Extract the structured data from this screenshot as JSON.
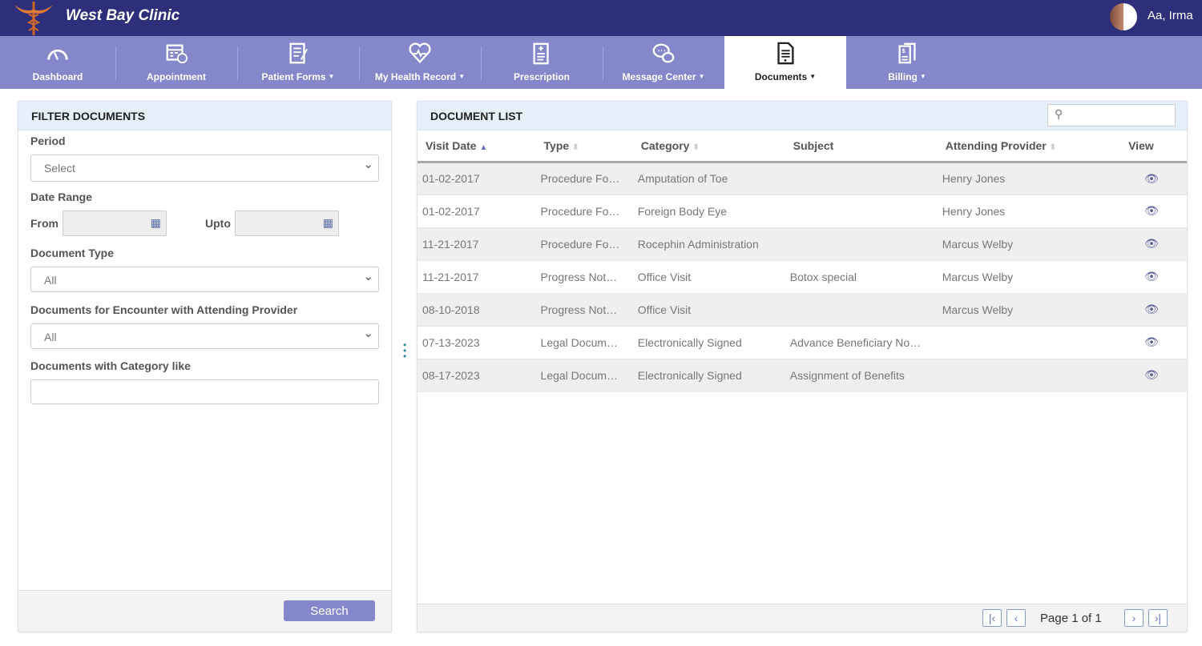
{
  "header": {
    "brand": "West Bay Clinic",
    "user": "Aa, Irma"
  },
  "nav": [
    {
      "label": "Dashboard",
      "icon": "speedometer-icon",
      "caret": false
    },
    {
      "label": "Appointment",
      "icon": "calendar-clock-icon",
      "caret": false
    },
    {
      "label": "Patient Forms",
      "icon": "form-pen-icon",
      "caret": true
    },
    {
      "label": "My Health Record",
      "icon": "heart-pulse-icon",
      "caret": true
    },
    {
      "label": "Prescription",
      "icon": "prescription-icon",
      "caret": false
    },
    {
      "label": "Message Center",
      "icon": "chat-bubbles-icon",
      "caret": true
    },
    {
      "label": "Documents",
      "icon": "document-icon",
      "caret": true,
      "active": true
    },
    {
      "label": "Billing",
      "icon": "billing-icon",
      "caret": true
    }
  ],
  "filter": {
    "title": "FILTER DOCUMENTS",
    "period_label": "Period",
    "period_value": "Select",
    "date_range_label": "Date Range",
    "from_label": "From",
    "upto_label": "Upto",
    "doc_type_label": "Document Type",
    "doc_type_value": "All",
    "provider_label": "Documents for Encounter with Attending Provider",
    "provider_value": "All",
    "category_label": "Documents with Category like",
    "category_value": "",
    "search_label": "Search"
  },
  "list": {
    "title": "DOCUMENT LIST",
    "columns": [
      "Visit Date",
      "Type",
      "Category",
      "Subject",
      "Attending Provider",
      "View"
    ],
    "rows": [
      [
        "01-02-2017",
        "Procedure Fo…",
        "Amputation of Toe",
        "",
        "Henry Jones"
      ],
      [
        "01-02-2017",
        "Procedure Fo…",
        "Foreign Body Eye",
        "",
        "Henry Jones"
      ],
      [
        "11-21-2017",
        "Procedure Fo…",
        "Rocephin Administration",
        "",
        "Marcus Welby"
      ],
      [
        "11-21-2017",
        "Progress Not…",
        "Office Visit",
        "Botox special",
        "Marcus Welby"
      ],
      [
        "08-10-2018",
        "Progress Not…",
        "Office Visit",
        "",
        "Marcus Welby"
      ],
      [
        "07-13-2023",
        "Legal Docum…",
        "Electronically Signed",
        "Advance Beneficiary No…",
        ""
      ],
      [
        "08-17-2023",
        "Legal Docum…",
        "Electronically Signed",
        "Assignment of Benefits",
        ""
      ]
    ],
    "pager": "Page 1 of 1"
  }
}
